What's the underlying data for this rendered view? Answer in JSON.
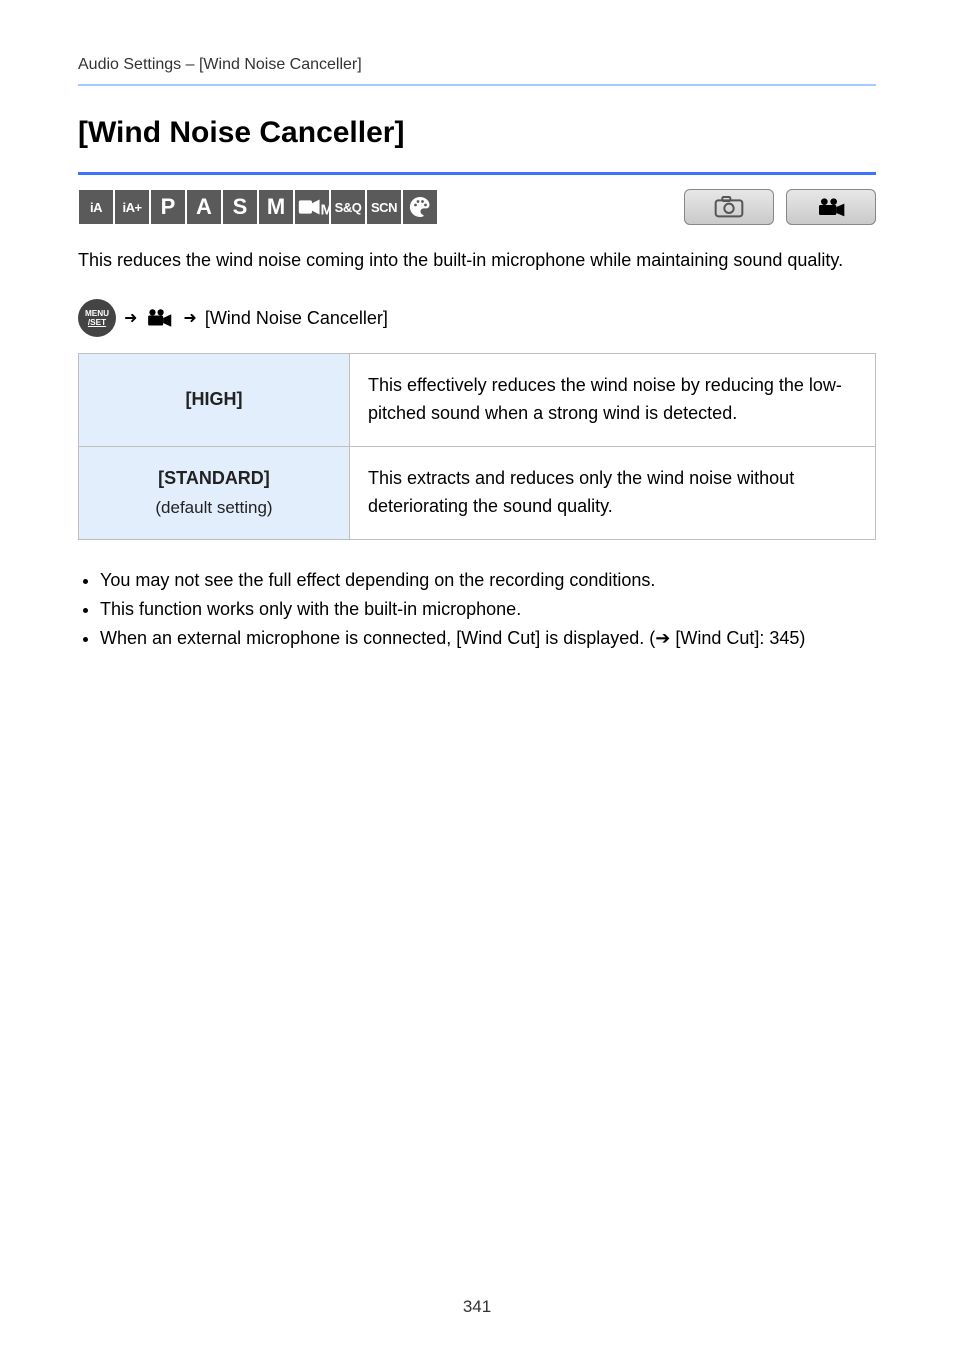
{
  "breadcrumb": "Audio Settings – [Wind Noise Canceller]",
  "title": "[Wind Noise Canceller]",
  "intro": "This reduces the wind noise coming into the built-in microphone while maintaining sound quality.",
  "nav_chain": {
    "item1_line1": "MENU",
    "item1_line2": "/SET",
    "item3": "[Wind Noise Canceller]"
  },
  "mode_icons": {
    "ia": "iA",
    "iaplus": "iA+",
    "p": "P",
    "a": "A",
    "s": "S",
    "m": "M",
    "videoM": "M",
    "sq": "S&Q",
    "scn": "SCN",
    "palette": "palette-icon"
  },
  "table": {
    "rows": [
      {
        "key": "[HIGH]",
        "desc": "This effectively reduces the wind noise by reducing the low-pitched sound when a strong wind is detected."
      },
      {
        "key": "[STANDARD]",
        "key_sub": "(default setting)",
        "desc": "This extracts and reduces only the wind noise without deteriorating the sound quality."
      }
    ]
  },
  "notes": {
    "list": [
      "You may not see the full effect depending on the recording conditions.",
      "This function works only with the built-in microphone.",
      "When an external microphone is connected, [Wind Cut] is displayed. (➔ [Wind Cut]: 345)"
    ]
  },
  "page_number": "341"
}
